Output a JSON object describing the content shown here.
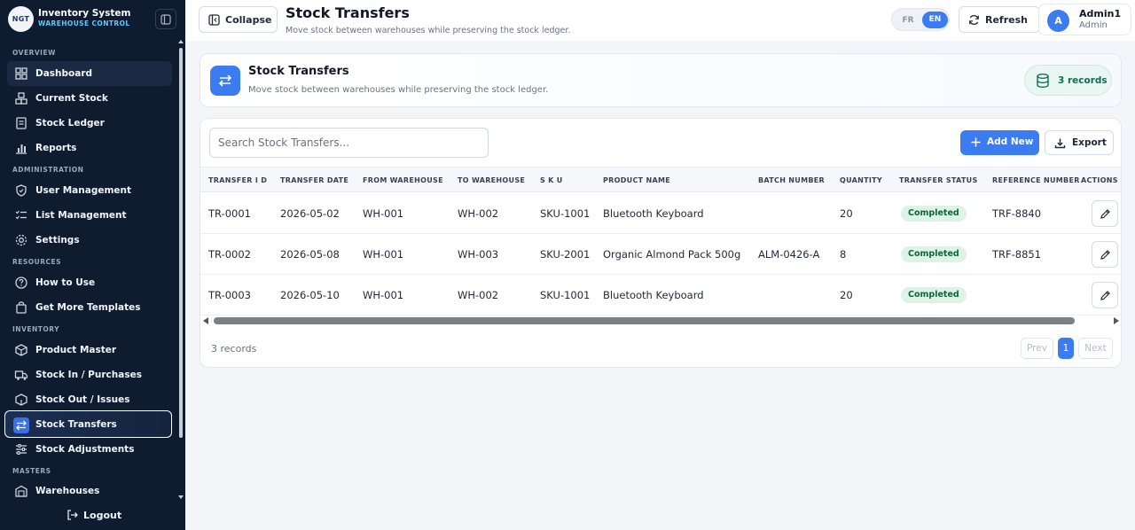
{
  "brand": {
    "logo_text": "NGT",
    "title": "Inventory System",
    "subtitle": "WAREHOUSE CONTROL"
  },
  "sidebar": {
    "sections": {
      "overview": "OVERVIEW",
      "administration": "ADMINISTRATION",
      "resources": "RESOURCES",
      "inventory": "INVENTORY",
      "masters": "MASTERS"
    },
    "items": {
      "dashboard": "Dashboard",
      "current_stock": "Current Stock",
      "stock_ledger": "Stock Ledger",
      "reports": "Reports",
      "user_management": "User Management",
      "list_management": "List Management",
      "settings": "Settings",
      "how_to_use": "How to Use",
      "get_more_templates": "Get More Templates",
      "product_master": "Product Master",
      "stock_in": "Stock In / Purchases",
      "stock_out": "Stock Out / Issues",
      "stock_transfers": "Stock Transfers",
      "stock_adjustments": "Stock Adjustments",
      "warehouses": "Warehouses"
    },
    "active_item": "stock_transfers",
    "logout": "Logout"
  },
  "header": {
    "collapse_label": "Collapse",
    "title": "Stock Transfers",
    "subtitle": "Move stock between warehouses while preserving the stock ledger.",
    "lang_fr": "FR",
    "lang_en": "EN",
    "active_lang": "EN",
    "refresh_label": "Refresh",
    "user_initial": "A",
    "user_name": "Admin1",
    "user_role": "Admin"
  },
  "hero": {
    "title": "Stock Transfers",
    "subtitle": "Move stock between warehouses while preserving the stock ledger.",
    "records_badge": "3 records"
  },
  "toolbar": {
    "search_placeholder": "Search Stock Transfers...",
    "add_label": "Add New",
    "export_label": "Export"
  },
  "table": {
    "columns": [
      "TRANSFER I D",
      "TRANSFER DATE",
      "FROM WAREHOUSE",
      "TO WAREHOUSE",
      "S K U",
      "PRODUCT NAME",
      "BATCH NUMBER",
      "QUANTITY",
      "TRANSFER STATUS",
      "REFERENCE NUMBER",
      "ACTIONS"
    ],
    "rows": [
      [
        "TR-0001",
        "2026-05-02",
        "WH-001",
        "WH-002",
        "SKU-1001",
        "Bluetooth Keyboard",
        "",
        "20",
        "Completed",
        "TRF-8840"
      ],
      [
        "TR-0002",
        "2026-05-08",
        "WH-001",
        "WH-003",
        "SKU-2001",
        "Organic Almond Pack 500g",
        "ALM-0426-A",
        "8",
        "Completed",
        "TRF-8851"
      ],
      [
        "TR-0003",
        "2026-05-10",
        "WH-001",
        "WH-002",
        "SKU-1001",
        "Bluetooth Keyboard",
        "",
        "20",
        "Completed",
        ""
      ]
    ]
  },
  "footer": {
    "count": "3 records",
    "prev": "Prev",
    "page": "1",
    "next": "Next"
  },
  "colors": {
    "sidebar_bg": "#0f1b2e",
    "accent": "#3b7cf2",
    "status_bg": "#def2e6",
    "status_text": "#10633e"
  }
}
